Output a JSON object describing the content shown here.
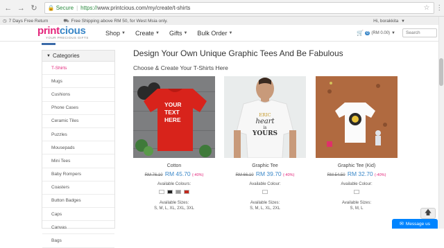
{
  "browser": {
    "secure_label": "Secure",
    "url_scheme": "https://",
    "url_rest": "www.printcious.com/my/create/t-shirts"
  },
  "promo": {
    "return": "7 Days Free Return",
    "shipping": "Free Shipping above RM 50, for West Msia only.",
    "greeting": "Hi, borakkita"
  },
  "header": {
    "logo_part1": "print",
    "logo_part2": "cious",
    "logo_tagline": "YOUR PRECIOUS GIFTS",
    "nav": [
      "Shop",
      "Create",
      "Gifts",
      "Bulk Order"
    ],
    "cart_count": "0",
    "cart_total": "RM 0.00",
    "search_placeholder": "Search"
  },
  "sidebar": {
    "heading": "Categories",
    "items": [
      "T-Shirts",
      "Mugs",
      "Cushions",
      "Phone Cases",
      "Ceramic Tiles",
      "Puzzles",
      "Mousepads",
      "Mini Tees",
      "Baby Rompers",
      "Coasters",
      "Button Badges",
      "Caps",
      "Canvas",
      "Bags"
    ],
    "active_index": 0
  },
  "main": {
    "title": "Design Your Own Unique Graphic Tees And Be Fabulous",
    "subtitle": "Choose & Create Your T-Shirts Here",
    "products": [
      {
        "name": "Cotton",
        "old_price": "RM 76.10",
        "new_price": "RM 45.70",
        "discount": "(-40%)",
        "colours_label": "Available Colours:",
        "colours": [
          "#ffffff",
          "#222222",
          "#9a9a9a",
          "#c0281c"
        ],
        "sizes_label": "Available Sizes:",
        "sizes": "S, M, L, XL, 2XL, 3XL",
        "shirt_text": [
          "YOUR",
          "TEXT",
          "HERE"
        ]
      },
      {
        "name": "Graphic Tee",
        "old_price": "RM 66.10",
        "new_price": "RM 39.70",
        "discount": "(-40%)",
        "colours_label": "Available Colour:",
        "colours": [
          "#ffffff"
        ],
        "sizes_label": "Available Sizes:",
        "sizes": "S, M, L, XL, 2XL",
        "graphic_lines": [
          "ERIC",
          "heart",
          "is",
          "YOURS"
        ]
      },
      {
        "name": "Graphic Tee (Kid)",
        "old_price": "RM 54.50",
        "new_price": "RM 32.70",
        "discount": "(-40%)",
        "colours_label": "Available Colour:",
        "colours": [
          "#ffffff"
        ],
        "sizes_label": "Available Sizes:",
        "sizes": "S, M, L"
      }
    ]
  },
  "widgets": {
    "messenger_label": "Message us"
  },
  "colors": {
    "brand_pink": "#e3257b",
    "brand_blue": "#3a87c8",
    "messenger_blue": "#0084ff"
  }
}
